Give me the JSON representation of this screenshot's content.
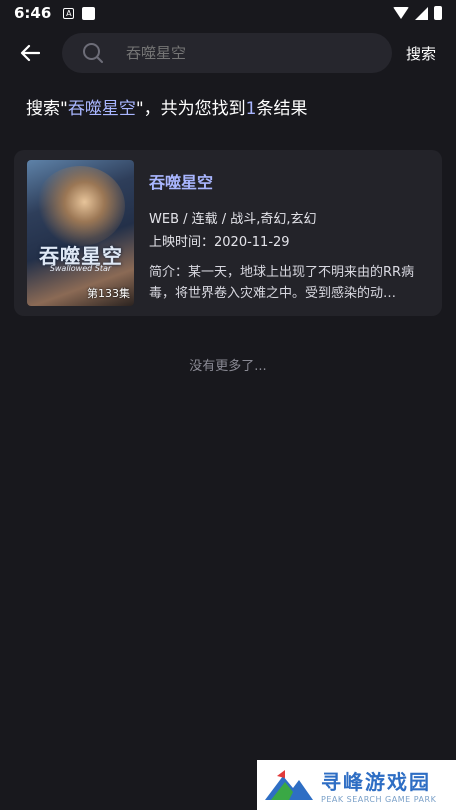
{
  "status_bar": {
    "time": "6:46",
    "notif_icon_letter": "A"
  },
  "search": {
    "placeholder": "吞噬星空",
    "button_label": "搜索"
  },
  "summary": {
    "prefix": "搜索\"",
    "keyword": "吞噬星空",
    "middle": "\"，共为您找到",
    "count": "1",
    "suffix": "条结果"
  },
  "results": [
    {
      "title": "吞噬星空",
      "poster_title": "吞噬星空",
      "poster_subtitle": "Swallowed Star",
      "poster_episode": "第133集",
      "meta": "WEB / 连载 / 战斗,奇幻,玄幻",
      "release": "上映时间：2020-11-29",
      "summary": "简介：某一天，地球上出现了不明来由的RR病毒，将世界卷入灾难之中。受到感染的动…"
    }
  ],
  "no_more_text": "没有更多了...",
  "watermark": {
    "cn": "寻峰游戏园",
    "en": "PEAK SEARCH GAME PARK"
  },
  "colors": {
    "background": "#18181d",
    "accent": "#a9b6ff",
    "card": "#232329"
  }
}
